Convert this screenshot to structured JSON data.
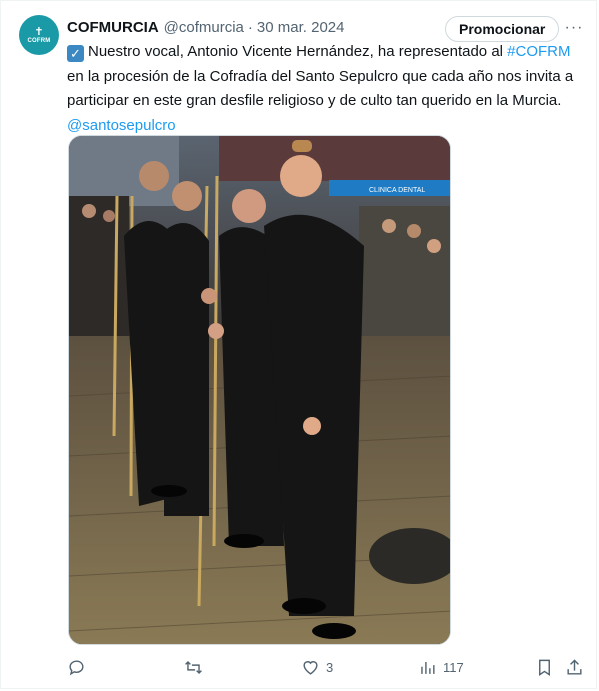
{
  "account": {
    "name": "COFMURCIA",
    "handle": "@cofmurcia",
    "separator": "·",
    "date": "30 mar. 2024",
    "avatar_text": "COFRM"
  },
  "header_actions": {
    "promote_label": "Promocionar",
    "more_icon": "more-dots-icon"
  },
  "tweet": {
    "check_emoji": "✓",
    "text_part1": "Nuestro vocal, Antonio Vicente Hernández, ha representado al ",
    "hashtag": "#COFRM",
    "text_part2": " en la procesión de la Cofradía del Santo Sepulcro que cada año nos invita a participar en este gran desfile religioso y de culto tan querido en la Murcia.",
    "mention": "@santosepulcro"
  },
  "media": {
    "type": "photo",
    "storefront_sign": "CLINICA DENTAL"
  },
  "actions": {
    "reply": {
      "icon": "reply-icon",
      "count": ""
    },
    "retweet": {
      "icon": "retweet-icon",
      "count": ""
    },
    "like": {
      "icon": "heart-icon",
      "count": "3"
    },
    "views": {
      "icon": "views-icon",
      "count": "117"
    },
    "bookmark": {
      "icon": "bookmark-icon"
    },
    "share": {
      "icon": "share-icon"
    }
  },
  "colors": {
    "link": "#1d9bf0",
    "muted": "#536471",
    "avatar_bg": "#1a9aa6",
    "check_bg": "#3b88c3"
  }
}
